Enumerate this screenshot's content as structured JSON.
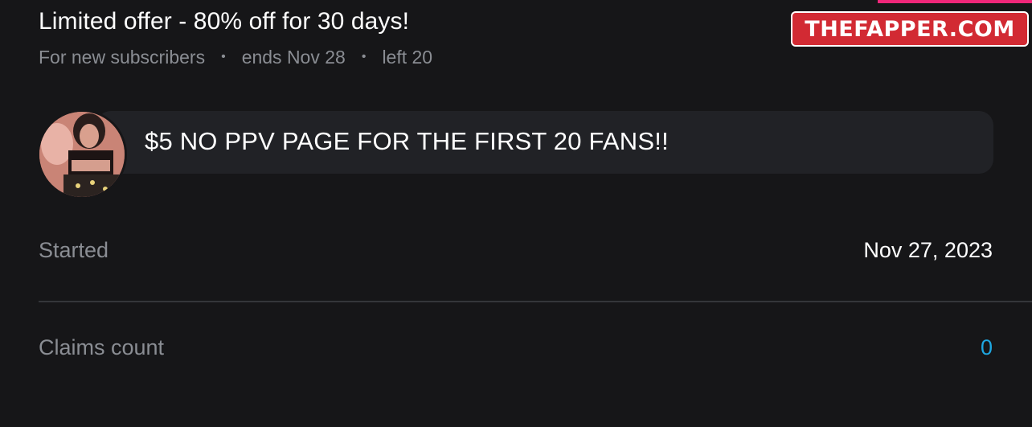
{
  "promo": {
    "title": "Limited offer - 80% off for 30 days!",
    "audience": "For new subscribers",
    "ends": "ends Nov 28",
    "left": "left 20",
    "separator": "•"
  },
  "offer": {
    "message": "$5 NO PPV PAGE FOR THE FIRST 20 FANS!!"
  },
  "details": {
    "started_label": "Started",
    "started_value": "Nov 27, 2023",
    "claims_label": "Claims count",
    "claims_value": "0"
  },
  "watermark": {
    "text": "THEFAPPER.COM"
  },
  "colors": {
    "background": "#161618",
    "card": "#212226",
    "muted_text": "#8a8d93",
    "accent_link": "#1ea7e1",
    "watermark_red": "#d22a33"
  }
}
